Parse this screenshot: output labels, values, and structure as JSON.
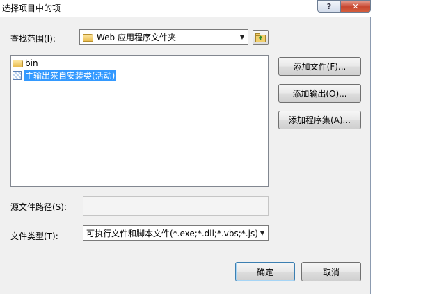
{
  "window": {
    "title": "选择项目中的项",
    "help_glyph": "?",
    "close_glyph": "✕"
  },
  "look_in": {
    "label": "查找范围(I):",
    "value": "Web 应用程序文件夹",
    "up_icon": "folder-up-icon"
  },
  "file_list": {
    "items": [
      {
        "label": "bin",
        "icon": "folder-icon",
        "selected": false
      },
      {
        "label": "主输出来自安装类(活动)",
        "icon": "project-output-icon",
        "selected": true
      }
    ]
  },
  "side_buttons": {
    "add_file": "添加文件(F)...",
    "add_output": "添加输出(O)...",
    "add_assembly": "添加程序集(A)..."
  },
  "source_path": {
    "label": "源文件路径(S):",
    "value": ""
  },
  "file_type": {
    "label": "文件类型(T):",
    "value": "可执行文件和脚本文件(*.exe;*.dll;*.vbs;*.js)"
  },
  "footer": {
    "ok": "确定",
    "cancel": "取消"
  },
  "colors": {
    "selection": "#3399ff",
    "dialog_bg": "#f0f0f0",
    "close_red": "#c7462f"
  }
}
